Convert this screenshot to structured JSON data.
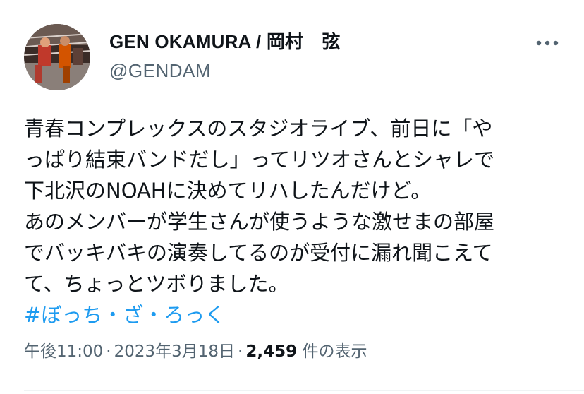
{
  "author": {
    "display_name": "GEN OKAMURA / 岡村　弦",
    "handle": "@GENDAM",
    "avatar": "wrestling-ring-photo"
  },
  "tweet": {
    "lines": [
      "青春コンプレックスのスタジオライブ、前日に「や",
      "っぱり結束バンドだし」ってリツオさんとシャレで",
      "下北沢のNOAHに決めてリハしたんだけど。",
      "あのメンバーが学生さんが使うような激せまの部屋",
      "でバッキバキの演奏してるのが受付に漏れ聞こえて",
      "て、ちょっとツボりました。"
    ],
    "hashtag": "#ぼっち・ざ・ろっく"
  },
  "meta": {
    "time": "午後11:00",
    "date": "2023年3月18日",
    "separator": "·",
    "views_count": "2,459",
    "views_label": "件の表示"
  },
  "icons": {
    "more": "more-horizontal-icon"
  },
  "colors": {
    "text": "#0f1419",
    "secondary": "#536471",
    "link": "#1d9bf0"
  }
}
